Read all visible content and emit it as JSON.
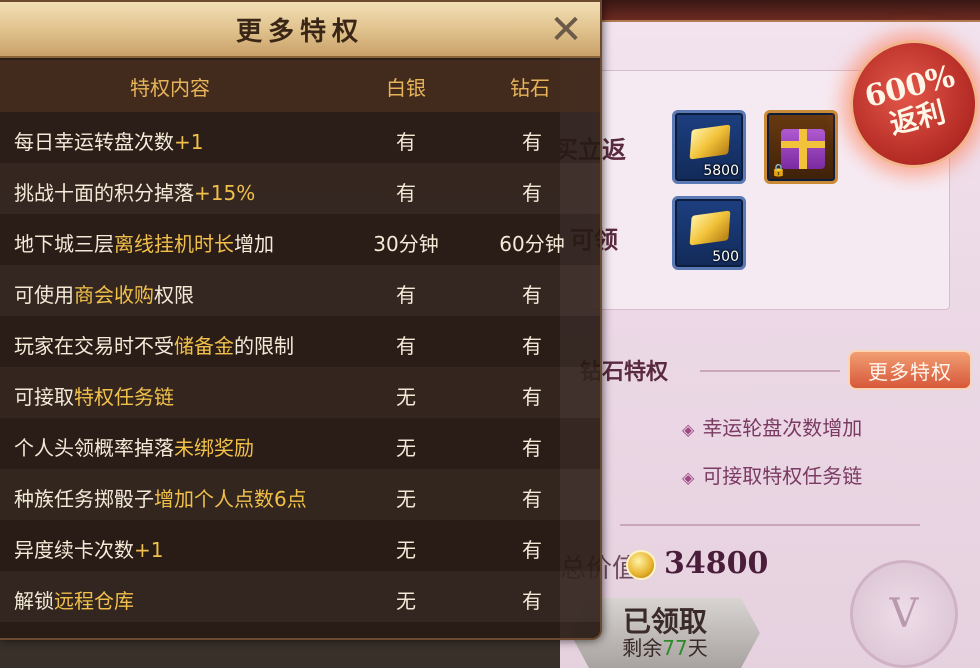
{
  "dialog": {
    "title": "更多特权",
    "columns": {
      "content": "特权内容",
      "silver": "白银",
      "diamond": "钻石"
    },
    "rows": [
      {
        "pre": "每日幸运转盘次数",
        "hl": "+1",
        "post": "",
        "silver": "有",
        "diamond": "有"
      },
      {
        "pre": "挑战十面的积分掉落",
        "hl": "+15%",
        "post": "",
        "silver": "有",
        "diamond": "有"
      },
      {
        "pre": "地下城三层",
        "hl": "离线挂机时长",
        "post": "增加",
        "silver": "30分钟",
        "diamond": "60分钟"
      },
      {
        "pre": "可使用",
        "hl": "商会收购",
        "post": "权限",
        "silver": "有",
        "diamond": "有"
      },
      {
        "pre": "玩家在交易时不受",
        "hl": "储备金",
        "post": "的限制",
        "silver": "有",
        "diamond": "有"
      },
      {
        "pre": "可接取",
        "hl": "特权任务链",
        "post": "",
        "silver": "无",
        "diamond": "有"
      },
      {
        "pre": "个人头领概率掉落",
        "hl": "未绑奖励",
        "post": "",
        "silver": "无",
        "diamond": "有"
      },
      {
        "pre": "种族任务掷骰子",
        "hl": "增加个人点数6点",
        "post": "",
        "silver": "无",
        "diamond": "有"
      },
      {
        "pre": "异度续卡次数",
        "hl": "+1",
        "post": "",
        "silver": "无",
        "diamond": "有"
      },
      {
        "pre": "解锁",
        "hl": "远程仓库",
        "post": "",
        "silver": "无",
        "diamond": "有"
      }
    ]
  },
  "background": {
    "label_buy_return": "购买立返",
    "label_daily": "可领",
    "items": [
      {
        "name": "gold-bar",
        "count": "5800"
      },
      {
        "name": "gift-box",
        "count": ""
      },
      {
        "name": "gold-bar",
        "count": "500"
      }
    ],
    "badge": {
      "percent": "600%",
      "text": "返利"
    },
    "section_title": "钻石特权",
    "more_button": "更多特权",
    "perks": [
      "幸运轮盘次数增加",
      "可接取特权任务链"
    ],
    "total_label": "总价值",
    "total_value": "34800",
    "claim_button": {
      "label": "已领取",
      "remain_pre": "剩余",
      "remain_num": "77",
      "remain_post": "天"
    },
    "medal_letter": "V"
  },
  "colors": {
    "highlight": "#f1c04a",
    "column_header": "#e8b45a",
    "dialog_bg": "#281a14",
    "header_gold": "#dfc08a"
  }
}
